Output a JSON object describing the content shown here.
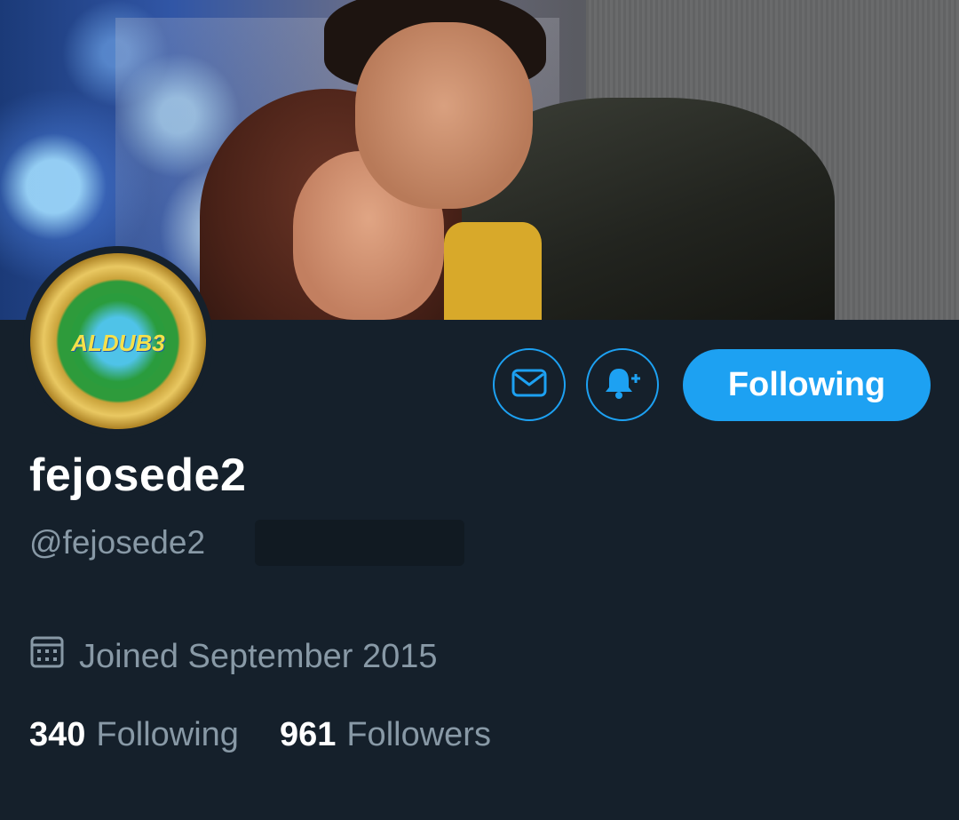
{
  "profile": {
    "display_name": "fejosede2",
    "handle": "@fejosede2",
    "joined": "Joined September 2015",
    "avatar_text": "ALDUB3",
    "following_count": "340",
    "following_label": "Following",
    "followers_count": "961",
    "followers_label": "Followers"
  },
  "actions": {
    "message_icon": "envelope-icon",
    "notify_icon": "bell-plus-icon",
    "follow_button_label": "Following"
  },
  "colors": {
    "background": "#15202b",
    "accent": "#1da1f2",
    "secondary_text": "#8899a6"
  }
}
